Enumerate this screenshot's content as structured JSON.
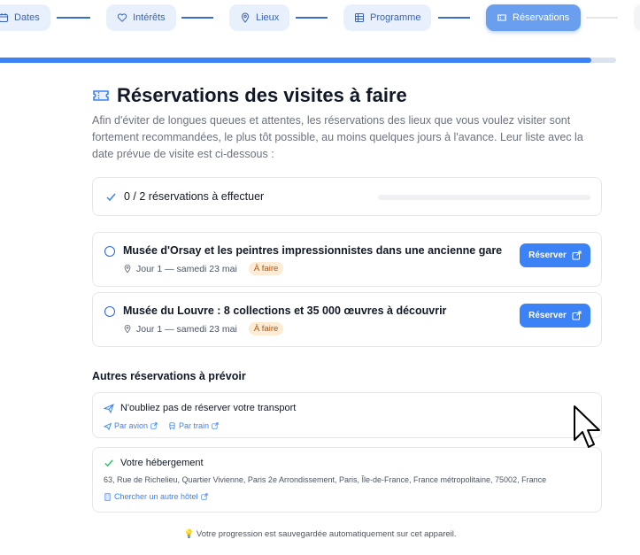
{
  "stepper": {
    "steps": [
      {
        "label": "Dates",
        "icon": "calendar-icon"
      },
      {
        "label": "Intérêts",
        "icon": "heart-icon"
      },
      {
        "label": "Lieux",
        "icon": "map-pin-icon"
      },
      {
        "label": "Programme",
        "icon": "grid-icon"
      },
      {
        "label": "Réservations",
        "icon": "ticket-icon",
        "active": true
      }
    ],
    "progress_fraction": 0.96
  },
  "page": {
    "title": "Réservations des visites à faire",
    "intro": "Afin d'éviter de longues queues et attentes, les réservations des lieux que vous voulez visiter sont fortement recommandées, le plus tôt possible, au moins quelques jours à l'avance. Leur liste avec la date prévue de visite est ci-dessous :"
  },
  "summary": {
    "label": "0 / 2 réservations à effectuer",
    "progress_fraction": 0
  },
  "reservations": [
    {
      "name": "Musée d'Orsay et les peintres impressionnistes dans une ancienne gare",
      "when": "Jour 1 — samedi 23 mai",
      "status": "À faire",
      "button": "Réserver"
    },
    {
      "name": "Musée du Louvre : 8 collections et 35 000 œuvres à découvrir",
      "when": "Jour 1 — samedi 23 mai",
      "status": "À faire",
      "button": "Réserver"
    }
  ],
  "other": {
    "title": "Autres réservations à prévoir",
    "transport": {
      "label": "N'oubliez pas de réserver votre transport",
      "links": [
        "Par avion",
        "Par train"
      ]
    },
    "hotel": {
      "label": "Votre hébergement",
      "address": "63, Rue de Richelieu, Quartier Vivienne, Paris 2e Arrondissement, Paris, Île-de-France, France métropolitaine, 75002, France",
      "link": "Chercher un autre hôtel"
    }
  },
  "footer": {
    "note": "Votre progression est sauvegardée automatiquement sur cet appareil."
  },
  "colors": {
    "accent": "#3b82f6",
    "badge_bg": "#fdebd3",
    "badge_text": "#b45309"
  }
}
